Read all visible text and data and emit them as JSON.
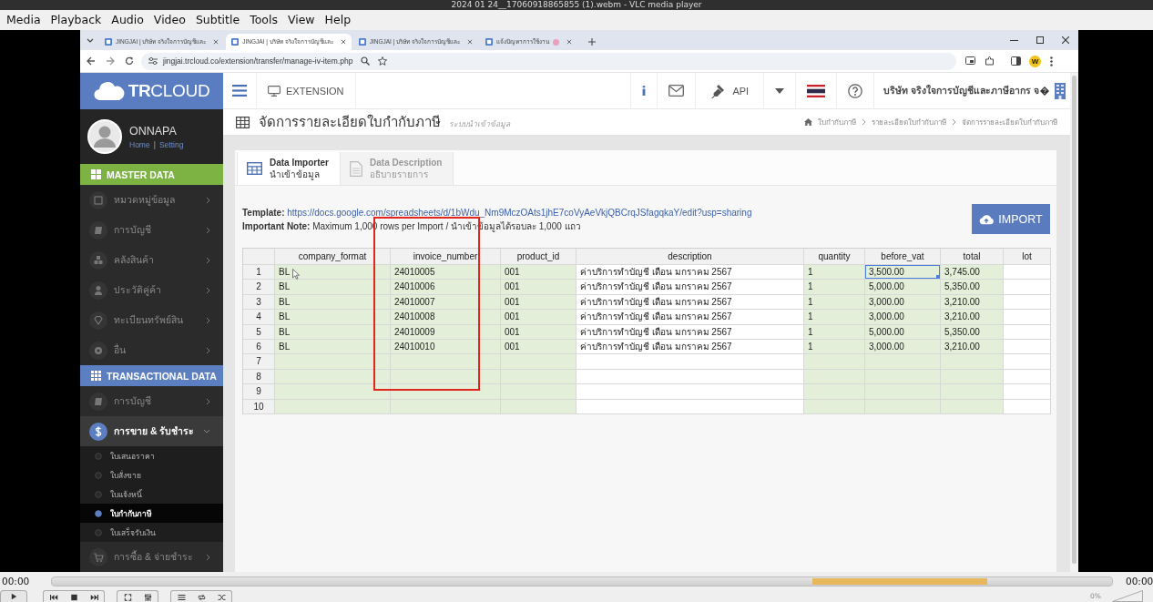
{
  "player": {
    "title": "2024 01 24__17060918865855 (1).webm - VLC media player",
    "menu": [
      "Media",
      "Playback",
      "Audio",
      "Video",
      "Subtitle",
      "Tools",
      "View",
      "Help"
    ],
    "elapsed": "00:00",
    "total": "00:00",
    "volume": {
      "reading": "0%",
      "level": 0
    }
  },
  "browser": {
    "tabs": [
      {
        "title": "JINGJAI | บริษัท จริงใจการบัญชีและ",
        "selected": false,
        "indicator": false
      },
      {
        "title": "JINGJAI | บริษัท จริงใจการบัญชีและ",
        "selected": true,
        "indicator": false
      },
      {
        "title": "JINGJAI | บริษัท จริงใจการบัญชีและ",
        "selected": false,
        "indicator": false
      },
      {
        "title": "แจ้งปัญหาการใช้งาน",
        "selected": false,
        "indicator": true
      }
    ],
    "url": "jingjai.trcloud.co/extension/transfer/manage-iv-item.php",
    "profile": "W"
  },
  "header": {
    "logo": "**TR**CLOUD",
    "module": "EXTENSION",
    "api": "API",
    "company": "บริษัท จริงใจการบัญชีและภาษีอากร จ"
  },
  "user": {
    "name": "ONNAPA",
    "links": [
      "Home",
      "Setting"
    ],
    "separator": "|"
  },
  "sidebar": [
    {
      "title": "MASTER DATA",
      "color": "#7cb342",
      "kind": "tiles",
      "items": [
        {
          "label": "หมวดหมู่ข้อมูล",
          "kind": "square",
          "expanded": false
        },
        {
          "label": "การบัญชี",
          "kind": "book",
          "expanded": false
        },
        {
          "label": "คลังสินค้า",
          "kind": "cubes",
          "expanded": false
        },
        {
          "label": "ประวัติคู่ค้า",
          "kind": "user",
          "expanded": false
        },
        {
          "label": "ทะเบียนทรัพย์สิน",
          "kind": "diamond",
          "expanded": false
        },
        {
          "label": "อื่น",
          "kind": "gear",
          "expanded": false
        }
      ]
    },
    {
      "title": "TRANSACTIONAL DATA",
      "color": "#5b7fc0",
      "kind": "grid",
      "items": [
        {
          "label": "การบัญชี",
          "kind": "book",
          "expanded": false
        },
        {
          "label": "การขาย & รับชำระ",
          "kind": "dollar",
          "expanded": true,
          "children": [
            {
              "label": "ใบเสนอราคา",
              "selected": false
            },
            {
              "label": "ใบสั่งขาย",
              "selected": false
            },
            {
              "label": "ใบแจ้งหนี้",
              "selected": false
            },
            {
              "label": "ใบกำกับภาษี",
              "selected": true
            },
            {
              "label": "ใบเสร็จรับเงิน",
              "selected": false
            }
          ]
        },
        {
          "label": "การซื้อ & จ่ายชำระ",
          "kind": "cart",
          "expanded": false
        }
      ]
    }
  ],
  "page": {
    "title": "จัดการรายละเอียดใบกำกับภาษี",
    "subtitle": "ระบบนำเข้าข้อมูล",
    "breadcrumb": [
      "ใบกำกับภาษี",
      "รายละเอียดใบกำกับภาษี",
      "จัดการรายละเอียดใบกำกับภาษี"
    ]
  },
  "panel": {
    "tabs": [
      {
        "title": "Data Importer",
        "subtitle": "นำเข้าข้อมูล",
        "kind": "table",
        "selected": true
      },
      {
        "title": "Data Description",
        "subtitle": "อธิบายรายการ",
        "kind": "document",
        "selected": false
      }
    ],
    "template": {
      "label": "Template:",
      "url": "https://docs.google.com/spreadsheets/d/1bWdu_Nm9MczOAts1jhE7coVyAeVkjQBCrqJSfagqkaY/edit?usp=sharing"
    },
    "note": "**Important Note:** Maximum 1,000 rows per Import / นำเข้าข้อมูลได้รอบละ 1,000 แถว",
    "import_button": "IMPORT"
  },
  "table": {
    "columns": [
      {
        "name": "company_format",
        "highlighted": true
      },
      {
        "name": "invoice_number",
        "highlighted": true
      },
      {
        "name": "product_id",
        "highlighted": true
      },
      {
        "name": "description",
        "highlighted": false
      },
      {
        "name": "quantity",
        "highlighted": true
      },
      {
        "name": "before_vat",
        "highlighted": true
      },
      {
        "name": "total",
        "highlighted": true
      },
      {
        "name": "lot",
        "highlighted": false
      }
    ],
    "rows": [
      {
        "number": "1",
        "cells": [
          {
            "text": "BL",
            "selected": false
          },
          {
            "text": "24010005",
            "selected": false
          },
          {
            "text": "001",
            "selected": false
          },
          {
            "text": "ค่าบริการทำบัญชี เดือน มกราคม 2567",
            "selected": false
          },
          {
            "text": "1",
            "selected": false
          },
          {
            "text": "3,500.00",
            "selected": true
          },
          {
            "text": "3,745.00",
            "selected": false
          }
        ]
      },
      {
        "number": "2",
        "cells": [
          {
            "text": "BL",
            "selected": false
          },
          {
            "text": "24010006",
            "selected": false
          },
          {
            "text": "001",
            "selected": false
          },
          {
            "text": "ค่าบริการทำบัญชี เดือน มกราคม 2567",
            "selected": false
          },
          {
            "text": "1",
            "selected": false
          },
          {
            "text": "5,000.00",
            "selected": false
          },
          {
            "text": "5,350.00",
            "selected": false
          }
        ]
      },
      {
        "number": "3",
        "cells": [
          {
            "text": "BL",
            "selected": false
          },
          {
            "text": "24010007",
            "selected": false
          },
          {
            "text": "001",
            "selected": false
          },
          {
            "text": "ค่าบริการทำบัญชี เดือน มกราคม 2567",
            "selected": false
          },
          {
            "text": "1",
            "selected": false
          },
          {
            "text": "3,000.00",
            "selected": false
          },
          {
            "text": "3,210.00",
            "selected": false
          }
        ]
      },
      {
        "number": "4",
        "cells": [
          {
            "text": "BL",
            "selected": false
          },
          {
            "text": "24010008",
            "selected": false
          },
          {
            "text": "001",
            "selected": false
          },
          {
            "text": "ค่าบริการทำบัญชี เดือน มกราคม 2567",
            "selected": false
          },
          {
            "text": "1",
            "selected": false
          },
          {
            "text": "3,000.00",
            "selected": false
          },
          {
            "text": "3,210.00",
            "selected": false
          }
        ]
      },
      {
        "number": "5",
        "cells": [
          {
            "text": "BL",
            "selected": false
          },
          {
            "text": "24010009",
            "selected": false
          },
          {
            "text": "001",
            "selected": false
          },
          {
            "text": "ค่าบริการทำบัญชี เดือน มกราคม 2567",
            "selected": false
          },
          {
            "text": "1",
            "selected": false
          },
          {
            "text": "5,000.00",
            "selected": false
          },
          {
            "text": "5,350.00",
            "selected": false
          }
        ]
      },
      {
        "number": "6",
        "cells": [
          {
            "text": "BL",
            "selected": false
          },
          {
            "text": "24010010",
            "selected": false
          },
          {
            "text": "001",
            "selected": false
          },
          {
            "text": "ค่าบริการทำบัญชี เดือน มกราคม 2567",
            "selected": false
          },
          {
            "text": "1",
            "selected": false
          },
          {
            "text": "3,000.00",
            "selected": false
          },
          {
            "text": "3,210.00",
            "selected": false
          }
        ]
      },
      {
        "number": "7"
      },
      {
        "number": "8"
      },
      {
        "number": "9"
      },
      {
        "number": "10"
      }
    ],
    "annotation": {
      "kind": "rectangle"
    },
    "mouse_pointer": true
  }
}
